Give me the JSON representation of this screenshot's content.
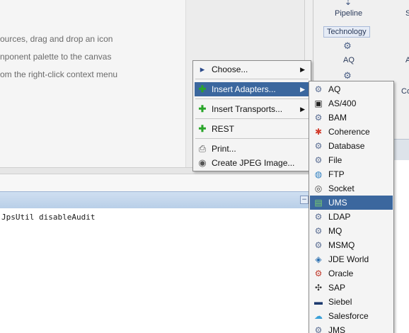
{
  "canvas": {
    "hint_lines": [
      "ources, drag and drop an icon",
      "nponent palette to the canvas",
      "om the right-click context menu"
    ]
  },
  "palette": {
    "pipeline_label": "Pipeline",
    "s_label": "S",
    "technology_label": "Technology",
    "aq_label": "AQ",
    "a_label": "A",
    "co_label": "Co"
  },
  "log": {
    "line": "JpsUtil disableAudit",
    "minimize_glyph": "−"
  },
  "context_menu": {
    "items": [
      {
        "label": "Choose...",
        "icon": "choose-icon",
        "glyph": "▸",
        "submenu": true
      },
      {
        "label": "Insert Adapters...",
        "icon": "add-icon",
        "glyph": "✚",
        "submenu": true,
        "selected": true
      },
      {
        "label": "Insert Transports...",
        "icon": "add-icon",
        "glyph": "✚",
        "submenu": true
      },
      {
        "label": "REST",
        "icon": "add-icon",
        "glyph": "✚",
        "submenu": false
      },
      {
        "label": "Print...",
        "icon": "printer-icon",
        "glyph": "⎙",
        "submenu": false
      },
      {
        "label": "Create JPEG Image...",
        "icon": "camera-icon",
        "glyph": "◉",
        "submenu": false
      }
    ],
    "arrow_glyph": "▶"
  },
  "adapters_menu": {
    "items": [
      {
        "label": "AQ",
        "icon": "gear-adapter-icon",
        "glyph": "⚙"
      },
      {
        "label": "AS/400",
        "icon": "terminal-icon",
        "glyph": "▣"
      },
      {
        "label": "BAM",
        "icon": "gear-adapter-icon",
        "glyph": "⚙"
      },
      {
        "label": "Coherence",
        "icon": "coherence-icon",
        "glyph": "✱"
      },
      {
        "label": "Database",
        "icon": "gear-adapter-icon",
        "glyph": "⚙"
      },
      {
        "label": "File",
        "icon": "gear-adapter-icon",
        "glyph": "⚙"
      },
      {
        "label": "FTP",
        "icon": "globe-icon",
        "glyph": "◍"
      },
      {
        "label": "Socket",
        "icon": "socket-icon",
        "glyph": "◎"
      },
      {
        "label": "UMS",
        "icon": "ums-icon",
        "glyph": "▤",
        "selected": true
      },
      {
        "label": "LDAP",
        "icon": "gear-adapter-icon",
        "glyph": "⚙"
      },
      {
        "label": "MQ",
        "icon": "gear-adapter-icon",
        "glyph": "⚙"
      },
      {
        "label": "MSMQ",
        "icon": "gear-adapter-icon",
        "glyph": "⚙"
      },
      {
        "label": "JDE World",
        "icon": "jde-icon",
        "glyph": "◈"
      },
      {
        "label": "Oracle",
        "icon": "oracle-icon",
        "glyph": "⚙"
      },
      {
        "label": "SAP",
        "icon": "sap-icon",
        "glyph": "✣"
      },
      {
        "label": "Siebel",
        "icon": "siebel-icon",
        "glyph": "▬"
      },
      {
        "label": "Salesforce",
        "icon": "salesforce-icon",
        "glyph": "☁"
      },
      {
        "label": "JMS",
        "icon": "gear-adapter-icon",
        "glyph": "⚙"
      }
    ]
  },
  "colors": {
    "selection": "#3b679e",
    "add_green": "#2aa52a"
  }
}
